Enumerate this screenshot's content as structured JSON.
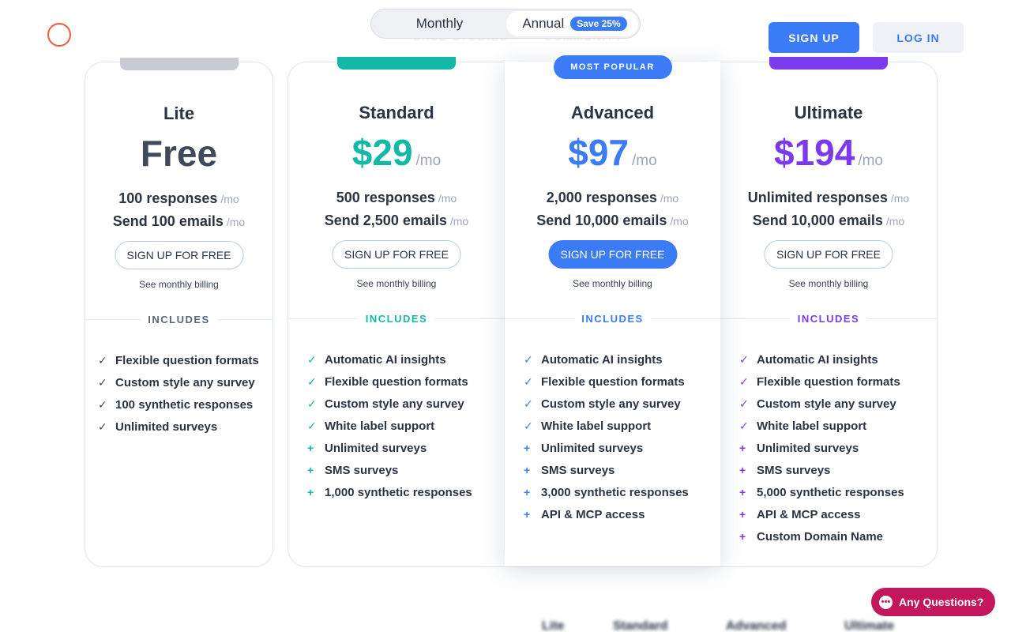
{
  "header": {
    "nav_ghost": [
      "CASE STUDIES",
      "COMMUNITY"
    ],
    "signup_label": "SIGN UP",
    "login_label": "LOG IN"
  },
  "billing_toggle": {
    "monthly_label": "Monthly",
    "annual_label": "Annual",
    "save_badge": "Save 25%",
    "selected": "Annual"
  },
  "plans": [
    {
      "name": "Lite",
      "price": "Free",
      "per": "",
      "color": "#3f4b5b",
      "responses": "100 responses",
      "emails": "Send 100 emails",
      "unit": "/mo",
      "cta": "SIGN UP FOR FREE",
      "billing_note": "See monthly billing",
      "includes_label": "INCLUDES",
      "features": [
        {
          "mark": "check",
          "text": "Flexible question formats"
        },
        {
          "mark": "check",
          "text": "Custom style any survey"
        },
        {
          "mark": "check",
          "text": "100 synthetic responses"
        },
        {
          "mark": "check",
          "text": "Unlimited surveys"
        }
      ]
    },
    {
      "name": "Standard",
      "price": "$29",
      "per": "/mo",
      "color": "#14b8a6",
      "responses": "500 responses",
      "emails": "Send 2,500 emails",
      "unit": "/mo",
      "cta": "SIGN UP FOR FREE",
      "billing_note": "See monthly billing",
      "includes_label": "INCLUDES",
      "features": [
        {
          "mark": "check",
          "text": "Automatic AI insights"
        },
        {
          "mark": "check",
          "text": "Flexible question formats"
        },
        {
          "mark": "check",
          "text": "Custom style any survey"
        },
        {
          "mark": "check",
          "text": "White label support"
        },
        {
          "mark": "plus",
          "text": "Unlimited surveys"
        },
        {
          "mark": "plus",
          "text": "SMS surveys"
        },
        {
          "mark": "plus",
          "text": "1,000 synthetic responses"
        }
      ]
    },
    {
      "name": "Advanced",
      "price": "$97",
      "per": "/mo",
      "color": "#3b7cf6",
      "badge": "MOST POPULAR",
      "responses": "2,000 responses",
      "emails": "Send 10,000 emails",
      "unit": "/mo",
      "cta": "SIGN UP FOR FREE",
      "billing_note": "See monthly billing",
      "includes_label": "INCLUDES",
      "features": [
        {
          "mark": "check",
          "text": "Automatic AI insights"
        },
        {
          "mark": "check",
          "text": "Flexible question formats"
        },
        {
          "mark": "check",
          "text": "Custom style any survey"
        },
        {
          "mark": "check",
          "text": "White label support"
        },
        {
          "mark": "plus",
          "text": "Unlimited surveys"
        },
        {
          "mark": "plus",
          "text": "SMS surveys"
        },
        {
          "mark": "plus",
          "text": "3,000 synthetic responses"
        },
        {
          "mark": "plus",
          "text": "API & MCP access"
        }
      ]
    },
    {
      "name": "Ultimate",
      "price": "$194",
      "per": "/mo",
      "color": "#7c3aed",
      "responses": "Unlimited responses",
      "emails": "Send 10,000 emails",
      "unit": "/mo",
      "cta": "SIGN UP FOR FREE",
      "billing_note": "See monthly billing",
      "includes_label": "INCLUDES",
      "features": [
        {
          "mark": "check",
          "text": "Automatic AI insights"
        },
        {
          "mark": "check",
          "text": "Flexible question formats"
        },
        {
          "mark": "check",
          "text": "Custom style any survey"
        },
        {
          "mark": "check",
          "text": "White label support"
        },
        {
          "mark": "plus",
          "text": "Unlimited surveys"
        },
        {
          "mark": "plus",
          "text": "SMS surveys"
        },
        {
          "mark": "plus",
          "text": "5,000 synthetic responses"
        },
        {
          "mark": "plus",
          "text": "API & MCP access"
        },
        {
          "mark": "plus",
          "text": "Custom Domain Name"
        }
      ]
    }
  ],
  "comparison_header": [
    "Lite",
    "Standard",
    "Advanced",
    "Ultimate"
  ],
  "chat": {
    "label": "Any Questions?",
    "icon": "chat-bubble-icon"
  },
  "colors": {
    "accent": "#3b7cf6",
    "brand_logo": "#ee5a3a",
    "chat": "#c2185b",
    "lite_tab": "#c8ccd2",
    "standard_tab": "#14b8a6",
    "ultimate_tab": "#7c3aed"
  }
}
